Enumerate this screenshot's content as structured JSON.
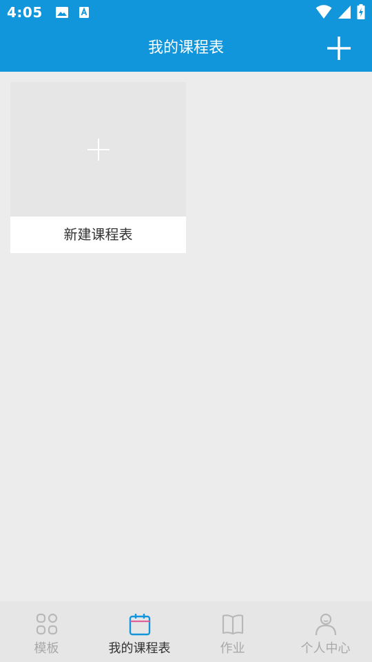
{
  "status_bar": {
    "time": "4:05",
    "icons": [
      "image-icon",
      "text-a-icon",
      "wifi-icon",
      "signal-icon",
      "battery-icon"
    ]
  },
  "app_bar": {
    "title": "我的课程表",
    "add_icon": "plus-icon"
  },
  "cards": [
    {
      "label": "新建课程表",
      "icon": "plus-icon"
    }
  ],
  "bottom_nav": {
    "active_index": 1,
    "items": [
      {
        "label": "模板",
        "icon": "grid-icon"
      },
      {
        "label": "我的课程表",
        "icon": "calendar-icon"
      },
      {
        "label": "作业",
        "icon": "book-icon"
      },
      {
        "label": "个人中心",
        "icon": "person-icon"
      }
    ]
  },
  "colors": {
    "primary": "#1296db",
    "background": "#ececec",
    "nav_inactive": "#a8a8a8",
    "nav_active_icon": "#1296db"
  }
}
